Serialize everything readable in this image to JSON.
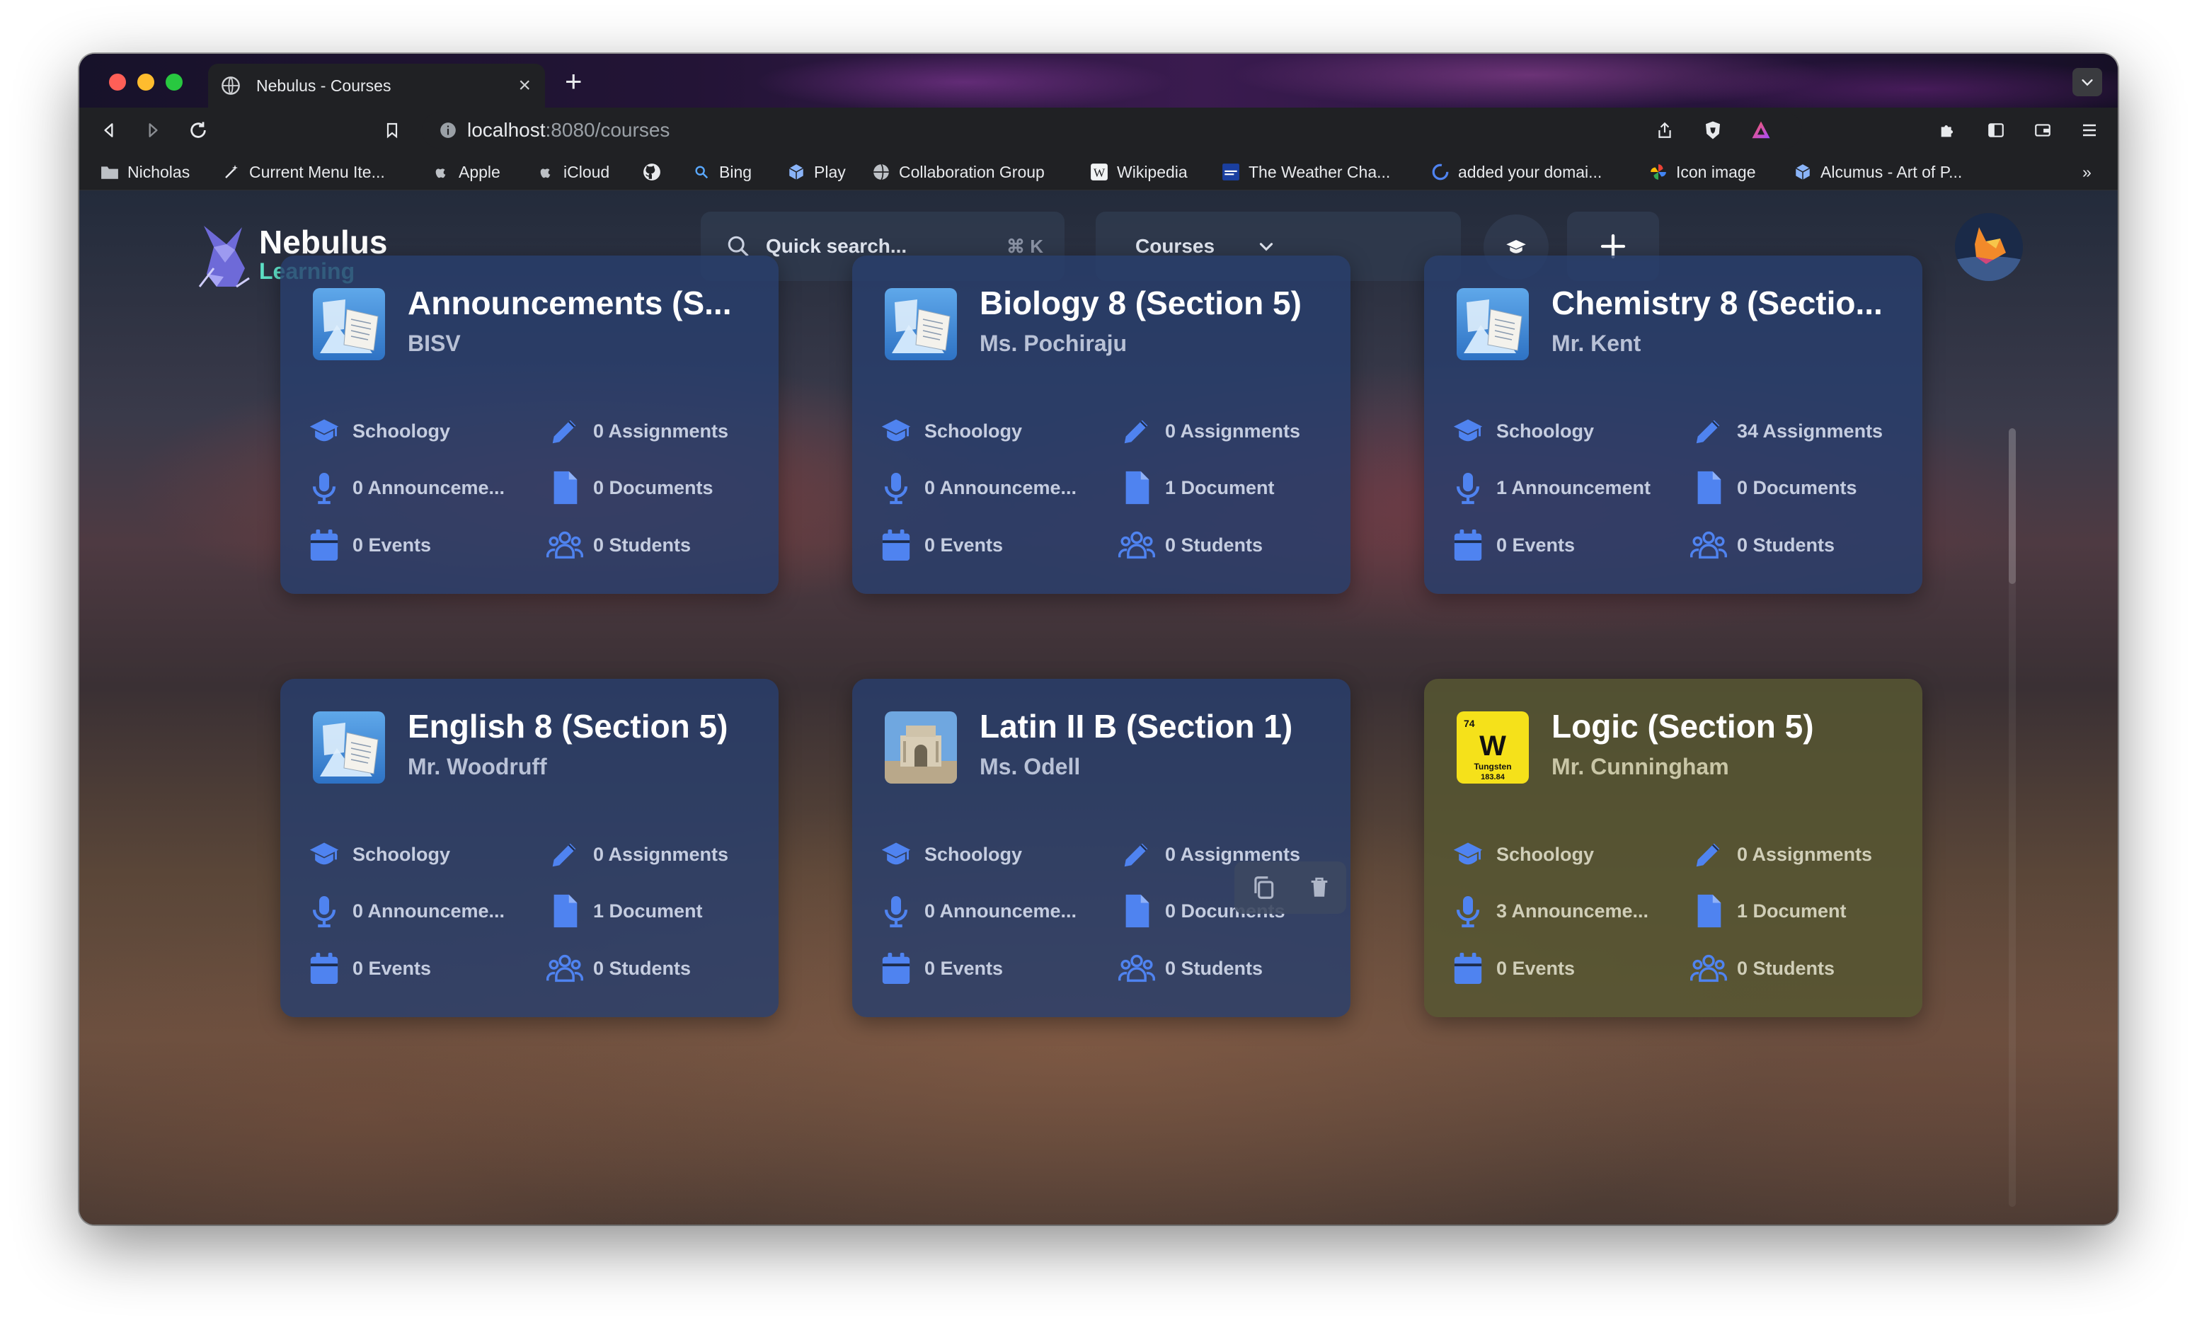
{
  "browser": {
    "tab_title": "Nebulus - Courses",
    "url_host": "localhost",
    "url_rest": ":8080/courses",
    "bookmarks": [
      "Nicholas",
      "Current Menu Ite...",
      "Apple",
      "iCloud",
      "",
      "Bing",
      "Play",
      "Collaboration Group",
      "Wikipedia",
      "The Weather Cha...",
      "added your domai...",
      "Icon image",
      "Alcumus - Art of P..."
    ],
    "bookmarks_overflow": "»"
  },
  "header": {
    "logo_title": "Nebulus",
    "logo_subtitle": "Learning",
    "search_placeholder": "Quick search...",
    "search_shortcut": "⌘ K",
    "courses_select": "Courses"
  },
  "stat_labels": {
    "platform": "Schoology"
  },
  "courses": [
    {
      "name": "Announcements (S...",
      "teacher": "BISV",
      "assignments": "0 Assignments",
      "announcements": "0 Announceme...",
      "documents": "0 Documents",
      "events": "0 Events",
      "students": "0 Students",
      "icon": "book-image-icon"
    },
    {
      "name": "Biology 8 (Section 5)",
      "teacher": "Ms. Pochiraju",
      "assignments": "0 Assignments",
      "announcements": "0 Announceme...",
      "documents": "1 Document",
      "events": "0 Events",
      "students": "0 Students",
      "icon": "book-image-icon"
    },
    {
      "name": "Chemistry 8 (Sectio...",
      "teacher": "Mr. Kent",
      "assignments": "34 Assignments",
      "announcements": "1 Announcement",
      "documents": "0 Documents",
      "events": "0 Events",
      "students": "0 Students",
      "icon": "book-image-icon"
    },
    {
      "name": "English 8 (Section 5)",
      "teacher": "Mr. Woodruff",
      "assignments": "0 Assignments",
      "announcements": "0 Announceme...",
      "documents": "1 Document",
      "events": "0 Events",
      "students": "0 Students",
      "icon": "book-image-icon"
    },
    {
      "name": "Latin II B (Section 1)",
      "teacher": "Ms. Odell",
      "assignments": "0 Assignments",
      "announcements": "0 Announceme...",
      "documents": "0 Documents",
      "events": "0 Events",
      "students": "0 Students",
      "icon": "monument-photo-icon"
    },
    {
      "name": "Logic (Section 5)",
      "teacher": "Mr. Cunningham",
      "assignments": "0 Assignments",
      "announcements": "3 Announceme...",
      "documents": "1 Document",
      "events": "0 Events",
      "students": "0 Students",
      "icon": "tungsten-element-icon"
    }
  ],
  "tungsten_tile": {
    "number": "74",
    "symbol": "W",
    "name": "Tungsten",
    "mass": "183.84"
  },
  "colors": {
    "card_blue": "#283e6c",
    "card_olive": "#565632",
    "icon_blue": "#4f83f0",
    "logo_accent": "#5ee0c6"
  }
}
